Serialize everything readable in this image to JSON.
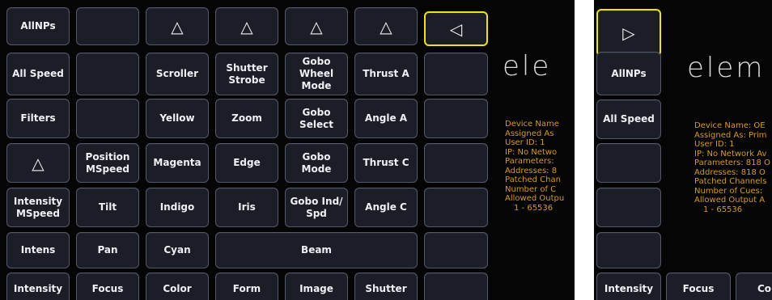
{
  "panel_a": {
    "row1": {
      "allnps": "AllNPs",
      "blank1": "",
      "tri_scroller": "△",
      "tri_shutter": "△",
      "tri_gobo": "△",
      "tri_thrust": "△",
      "tri_left": "◁"
    },
    "row2": {
      "all_speed": "All Speed",
      "blank": "",
      "scroller": "Scroller",
      "shutter_strobe": "Shutter\nStrobe",
      "gobo_wheel_mode": "Gobo\nWheel\nMode",
      "thrust_a": "Thrust A",
      "blank_right": ""
    },
    "row3": {
      "filters": "Filters",
      "blank": "",
      "yellow": "Yellow",
      "zoom": "Zoom",
      "gobo_select": "Gobo\nSelect",
      "angle_a": "Angle A",
      "blank_right": ""
    },
    "row4": {
      "tri_up": "△",
      "position_mspeed": "Position\nMSpeed",
      "magenta": "Magenta",
      "edge": "Edge",
      "gobo_mode": "Gobo\nMode",
      "thrust_c": "Thrust C",
      "blank_right": ""
    },
    "row5": {
      "intensity_mspeed": "Intensity\nMSpeed",
      "tilt": "Tilt",
      "indigo": "Indigo",
      "iris": "Iris",
      "gobo_ind_spd": "Gobo Ind/\nSpd",
      "angle_c": "Angle C",
      "blank_right": ""
    },
    "row6": {
      "intens": "Intens",
      "pan": "Pan",
      "cyan": "Cyan",
      "beam": "Beam",
      "blank_right": ""
    },
    "tabs": {
      "intensity": "Intensity",
      "focus": "Focus",
      "color": "Color",
      "form": "Form",
      "image": "Image",
      "shutter": "Shutter",
      "blank": ""
    },
    "logo": "ele",
    "info": [
      "Device Name",
      "Assigned As",
      "User ID: 1",
      "IP: No Netwo",
      "Parameters:",
      "Addresses: 8",
      "Patched Chan",
      "Number of C",
      "Allowed Outpu",
      "1 - 65536"
    ]
  },
  "panel_b": {
    "tri_right": "▷",
    "allnps": "AllNPs",
    "all_speed": "All Speed",
    "tabs": {
      "intensity": "Intensity",
      "focus": "Focus",
      "color": "Col"
    },
    "logo": "elem",
    "info": [
      "Device Name: OE",
      "Assigned As: Prim",
      "User ID: 1",
      "IP: No Network Av",
      "Parameters: 818 O",
      "Addresses: 818 O",
      "Patched Channels",
      "Number of Cues:",
      "Allowed Output A",
      "1 - 65536"
    ]
  },
  "colors": {
    "background": "#050505",
    "button_face": "#1b1d27",
    "button_border": "#55586a",
    "selection": "#efe318",
    "info_text": "#d89a1c"
  }
}
